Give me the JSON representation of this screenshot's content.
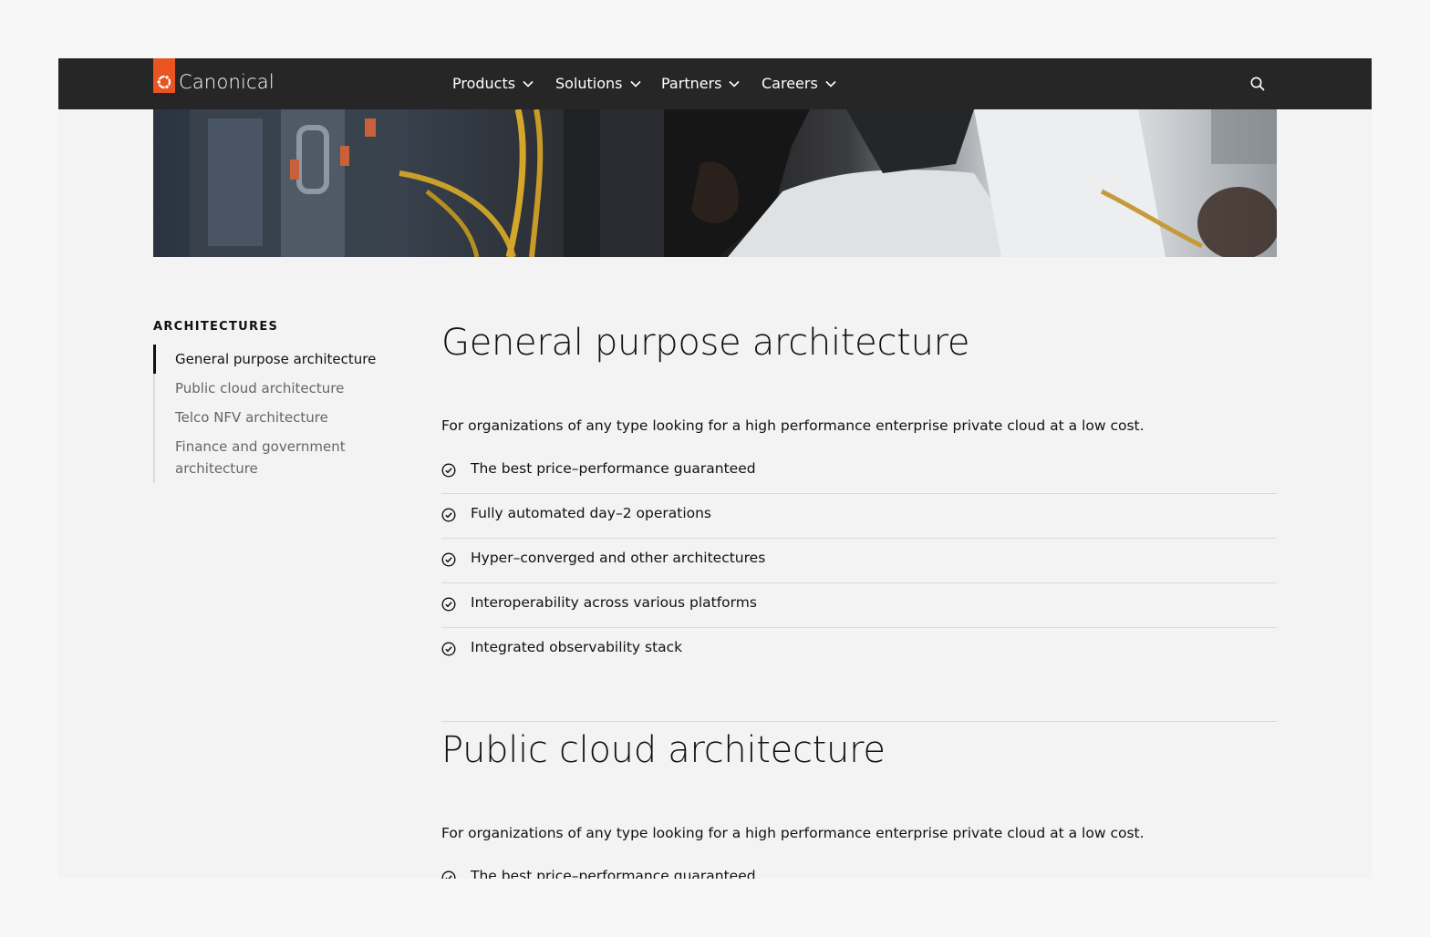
{
  "brand": {
    "name": "Canonical",
    "accent": "#e95420",
    "nav_bg": "#262626"
  },
  "nav": {
    "items": [
      {
        "label": "Products"
      },
      {
        "label": "Solutions"
      },
      {
        "label": "Partners"
      },
      {
        "label": "Careers"
      }
    ],
    "search_icon": "search-icon"
  },
  "sidebar": {
    "heading": "ARCHITECTURES",
    "items": [
      {
        "label": "General purpose architecture",
        "active": true
      },
      {
        "label": "Public cloud architecture",
        "active": false
      },
      {
        "label": "Telco NFV architecture",
        "active": false
      },
      {
        "label": "Finance and government architecture",
        "active": false
      }
    ]
  },
  "sections": [
    {
      "title": "General purpose architecture",
      "description": "For organizations of any type looking for a high performance enterprise private cloud at a low cost.",
      "features": [
        "The best price–performance guaranteed",
        "Fully automated day–2 operations",
        "Hyper–converged and other architectures",
        "Interoperability across various platforms",
        "Integrated observability stack"
      ]
    },
    {
      "title": "Public cloud architecture",
      "description": "For organizations of any type looking for a high performance enterprise private cloud at a low cost.",
      "features": [
        "The best price–performance guaranteed"
      ]
    }
  ],
  "icons": {
    "feature": "check-circle-icon",
    "nav_dropdown": "chevron-down-icon"
  }
}
